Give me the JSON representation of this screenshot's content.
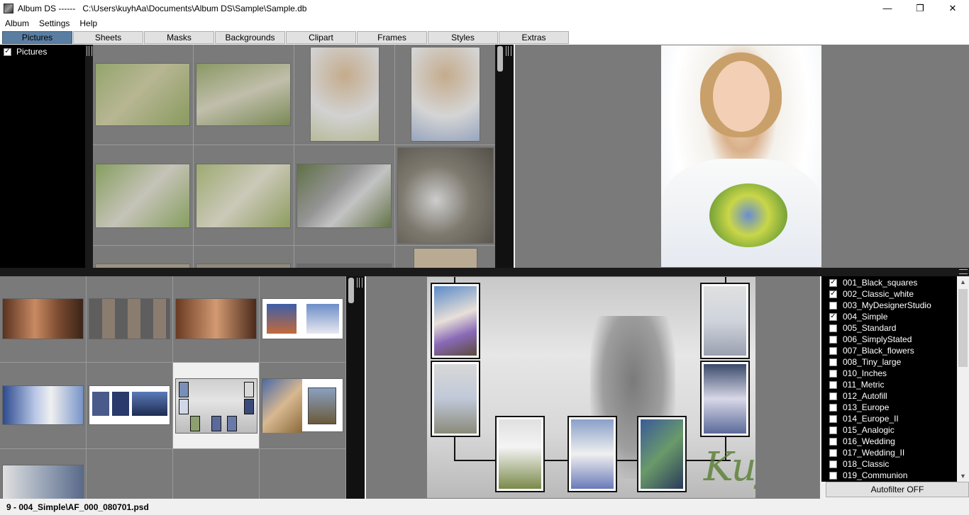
{
  "window": {
    "title": "Album DS ------   C:\\Users\\kuyhAa\\Documents\\Album DS\\Sample\\Sample.db",
    "minimize": "—",
    "maximize": "❐",
    "close": "✕"
  },
  "menu": {
    "items": [
      "Album",
      "Settings",
      "Help"
    ]
  },
  "tabs": {
    "items": [
      "Pictures",
      "Sheets",
      "Masks",
      "Backgrounds",
      "Clipart",
      "Frames",
      "Styles",
      "Extras"
    ],
    "active": "Pictures"
  },
  "tree": {
    "items": [
      {
        "label": "Pictures",
        "checked": true
      }
    ]
  },
  "filters": {
    "items": [
      {
        "label": "001_Black_squares",
        "checked": true
      },
      {
        "label": "002_Classic_white",
        "checked": true
      },
      {
        "label": "003_MyDesignerStudio",
        "checked": false
      },
      {
        "label": "004_Simple",
        "checked": true
      },
      {
        "label": "005_Standard",
        "checked": false
      },
      {
        "label": "006_SimplyStated",
        "checked": false
      },
      {
        "label": "007_Black_flowers",
        "checked": false
      },
      {
        "label": "008_Tiny_large",
        "checked": false
      },
      {
        "label": "010_Inches",
        "checked": false
      },
      {
        "label": "011_Metric",
        "checked": false
      },
      {
        "label": "012_Autofill",
        "checked": false
      },
      {
        "label": "013_Europe",
        "checked": false
      },
      {
        "label": "014_Europe_II",
        "checked": false
      },
      {
        "label": "015_Analogic",
        "checked": false
      },
      {
        "label": "016_Wedding",
        "checked": false
      },
      {
        "label": "017_Wedding_II",
        "checked": false
      },
      {
        "label": "018_Classic",
        "checked": false
      },
      {
        "label": "019_Communion",
        "checked": false
      }
    ],
    "autofilter_label": "Autofilter OFF"
  },
  "layout_preview": {
    "watermark": "KuyhAaMe"
  },
  "status": {
    "text": "9 - 004_Simple\\AF_000_080701.psd"
  },
  "colors": {
    "active_tab": "#5a7ea2",
    "panel_bg": "#808080",
    "dark_bg": "#000000"
  }
}
